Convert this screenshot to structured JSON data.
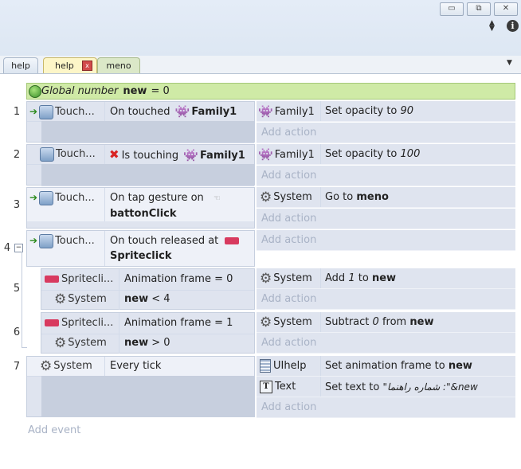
{
  "window": {
    "minimize": "▭",
    "restore": "⧉",
    "close": "✕",
    "info": "i"
  },
  "tabs": [
    {
      "label": "help"
    },
    {
      "label": "help"
    },
    {
      "label": "meno"
    }
  ],
  "tab_close": "x",
  "global_var": {
    "label": "Global number",
    "name": "new",
    "value": "= 0"
  },
  "add_action": "Add action",
  "add_event": "Add event",
  "events": [
    {
      "number": "1",
      "cond_object": "Touch...",
      "cond_text": "On touched",
      "cond_target": "Family1",
      "actions": [
        {
          "object": "Family1",
          "text": "Set opacity to",
          "value": "90"
        }
      ]
    },
    {
      "number": "2",
      "cond_object": "Touch...",
      "cond_text": "Is touching",
      "cond_target": "Family1",
      "actions": [
        {
          "object": "Family1",
          "text": "Set opacity to",
          "value": "100"
        }
      ]
    },
    {
      "number": "3",
      "cond_object": "Touch...",
      "cond_text": "On tap gesture on",
      "cond_target": "battonClick",
      "actions": [
        {
          "object": "System",
          "text": "Go to",
          "value": "meno"
        }
      ]
    },
    {
      "number": "4",
      "cond_object": "Touch...",
      "cond_text": "On touch released at",
      "cond_target": "Spriteclick"
    },
    {
      "number": "5",
      "conds": [
        {
          "object": "Spritecli...",
          "text": "Animation frame = 0"
        },
        {
          "object": "System",
          "text_bold": "new",
          "text": "< 4"
        }
      ],
      "actions": [
        {
          "object": "System",
          "pre": "Add",
          "value": "1",
          "mid": "to",
          "target": "new"
        }
      ]
    },
    {
      "number": "6",
      "conds": [
        {
          "object": "Spritecli...",
          "text": "Animation frame = 1"
        },
        {
          "object": "System",
          "text_bold": "new",
          "text": "> 0"
        }
      ],
      "actions": [
        {
          "object": "System",
          "pre": "Subtract",
          "value": "0",
          "mid": "from",
          "target": "new"
        }
      ]
    },
    {
      "number": "7",
      "cond_object": "System",
      "cond_text": "Every tick",
      "actions": [
        {
          "object": "UIhelp",
          "text": "Set animation frame to",
          "target": "new"
        },
        {
          "object": "Text",
          "text": "Set text to",
          "value": "\"شماره راهنما :\"&new"
        }
      ]
    }
  ]
}
